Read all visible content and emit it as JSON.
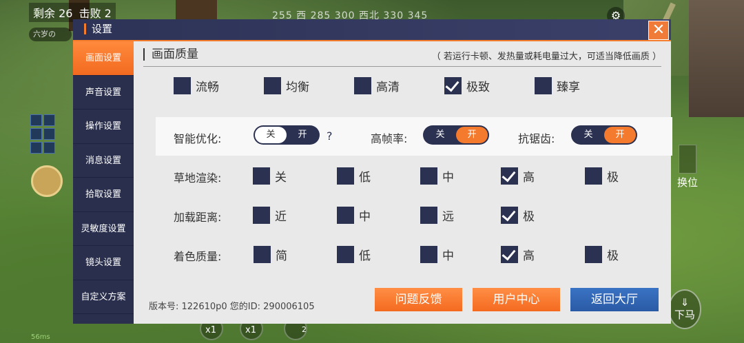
{
  "hud": {
    "remain_label": "剩余",
    "remain_count": "26",
    "kills_label": "击败",
    "kills_count": "2",
    "compass": "255  西  285 300 西北 330 345",
    "player_name": "六岁の",
    "swap_label": "换位",
    "dismount_label": "下马",
    "x1_a": "x1",
    "x1_b": "x1",
    "bag_count": "2",
    "ping": "56ms"
  },
  "dialog": {
    "title": "设置",
    "close": "✕"
  },
  "sidebar": {
    "tabs": [
      {
        "label": "画面设置",
        "active": true
      },
      {
        "label": "声音设置",
        "active": false
      },
      {
        "label": "操作设置",
        "active": false
      },
      {
        "label": "消息设置",
        "active": false
      },
      {
        "label": "拾取设置",
        "active": false
      },
      {
        "label": "灵敏度设置",
        "active": false
      },
      {
        "label": "镜头设置",
        "active": false
      },
      {
        "label": "自定义方案",
        "active": false
      }
    ]
  },
  "section": {
    "title": "画面质量",
    "note": "（ 若运行卡顿、发热量或耗电量过大，可适当降低画质 ）"
  },
  "quality": [
    {
      "label": "流畅",
      "checked": false
    },
    {
      "label": "均衡",
      "checked": false
    },
    {
      "label": "高清",
      "checked": false
    },
    {
      "label": "极致",
      "checked": true
    },
    {
      "label": "臻享",
      "checked": false
    }
  ],
  "toggles": {
    "smart": {
      "label": "智能优化:",
      "off": "关",
      "on": "开",
      "state": "off",
      "help": "?"
    },
    "hfr": {
      "label": "高帧率:",
      "off": "关",
      "on": "开",
      "state": "on"
    },
    "aa": {
      "label": "抗锯齿:",
      "off": "关",
      "on": "开",
      "state": "on"
    }
  },
  "grass": {
    "label": "草地渲染:",
    "options": [
      {
        "label": "关",
        "checked": false
      },
      {
        "label": "低",
        "checked": false
      },
      {
        "label": "中",
        "checked": false
      },
      {
        "label": "高",
        "checked": true
      },
      {
        "label": "极",
        "checked": false
      }
    ]
  },
  "distance": {
    "label": "加载距离:",
    "options": [
      {
        "label": "近",
        "checked": false
      },
      {
        "label": "中",
        "checked": false
      },
      {
        "label": "远",
        "checked": false
      },
      {
        "label": "极",
        "checked": true
      }
    ]
  },
  "shading": {
    "label": "着色质量:",
    "options": [
      {
        "label": "简",
        "checked": false
      },
      {
        "label": "低",
        "checked": false
      },
      {
        "label": "中",
        "checked": false
      },
      {
        "label": "高",
        "checked": true
      },
      {
        "label": "极",
        "checked": false
      }
    ]
  },
  "footer": {
    "version": "版本号:  122610p0    您的ID:  290006105",
    "feedback": "问题反馈",
    "user_center": "用户中心",
    "lobby": "返回大厅"
  },
  "colors": {
    "accent": "#f47a2d",
    "nav_bg": "#2a2f4d",
    "checkbox": "#2b3150",
    "blue_button": "#2a5aa5"
  }
}
